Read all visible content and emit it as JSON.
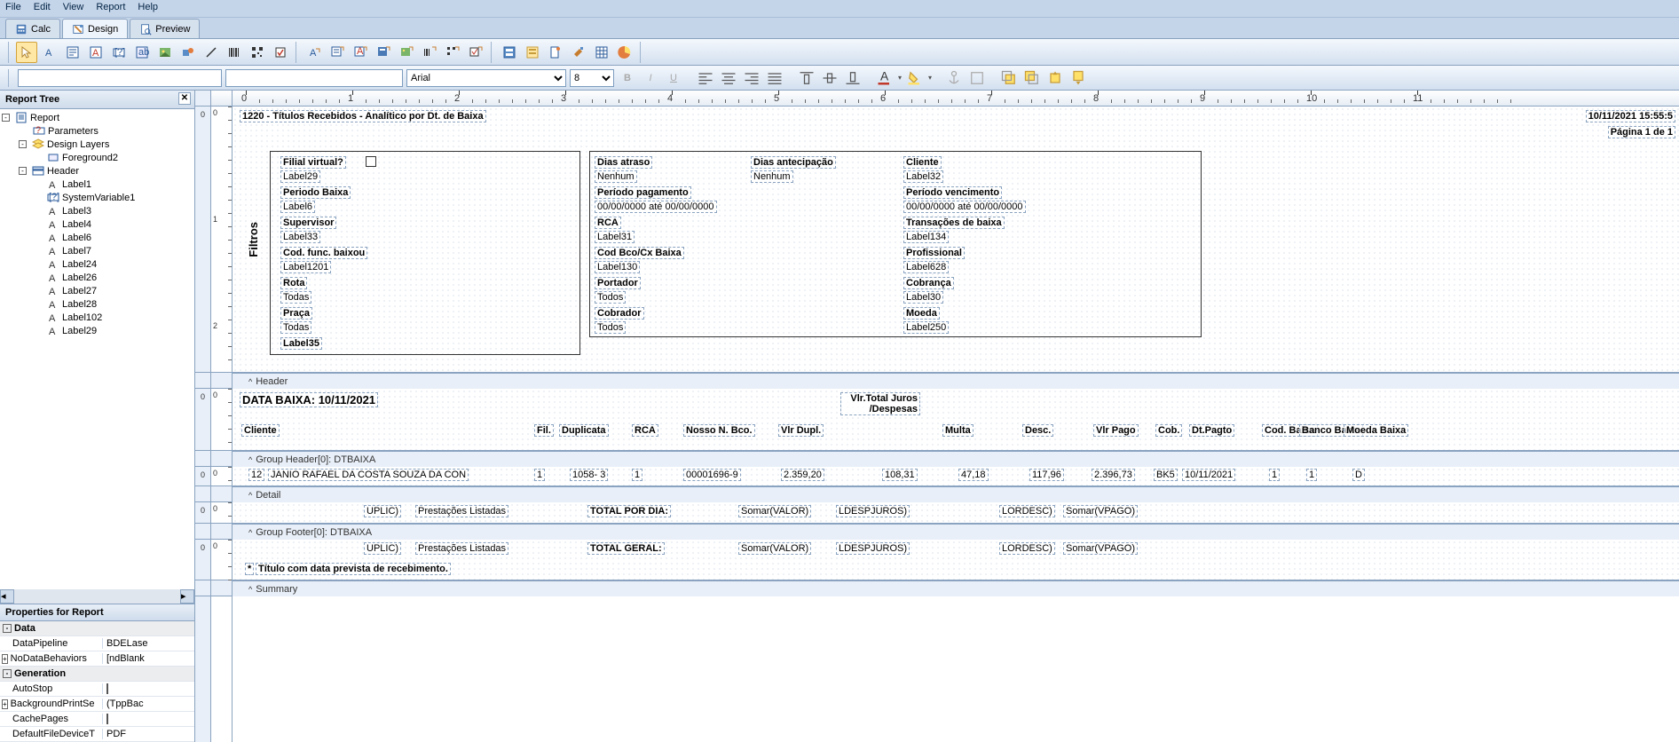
{
  "menu": {
    "file": "File",
    "edit": "Edit",
    "view": "View",
    "report": "Report",
    "help": "Help"
  },
  "tabs": {
    "calc": "Calc",
    "design": "Design",
    "preview": "Preview"
  },
  "fmt": {
    "font": "Arial",
    "size": "8"
  },
  "tree": {
    "title": "Report Tree",
    "root": "Report",
    "nodes": [
      {
        "indent": 1,
        "exp": "",
        "icon": "param",
        "label": "Parameters"
      },
      {
        "indent": 1,
        "exp": "-",
        "icon": "layers",
        "label": "Design Layers"
      },
      {
        "indent": 2,
        "exp": "",
        "icon": "layer",
        "label": "Foreground2"
      },
      {
        "indent": 1,
        "exp": "-",
        "icon": "band",
        "label": "Header"
      },
      {
        "indent": 2,
        "exp": "",
        "icon": "A",
        "label": "Label1"
      },
      {
        "indent": 2,
        "exp": "",
        "icon": "sys",
        "label": "SystemVariable1"
      },
      {
        "indent": 2,
        "exp": "",
        "icon": "A",
        "label": "Label3"
      },
      {
        "indent": 2,
        "exp": "",
        "icon": "A",
        "label": "Label4"
      },
      {
        "indent": 2,
        "exp": "",
        "icon": "A",
        "label": "Label6"
      },
      {
        "indent": 2,
        "exp": "",
        "icon": "A",
        "label": "Label7"
      },
      {
        "indent": 2,
        "exp": "",
        "icon": "A",
        "label": "Label24"
      },
      {
        "indent": 2,
        "exp": "",
        "icon": "A",
        "label": "Label26"
      },
      {
        "indent": 2,
        "exp": "",
        "icon": "A",
        "label": "Label27"
      },
      {
        "indent": 2,
        "exp": "",
        "icon": "A",
        "label": "Label28"
      },
      {
        "indent": 2,
        "exp": "",
        "icon": "A",
        "label": "Label102"
      },
      {
        "indent": 2,
        "exp": "",
        "icon": "A",
        "label": "Label29"
      }
    ]
  },
  "props": {
    "title": "Properties for Report",
    "groups": [
      {
        "name": "Data",
        "rows": [
          {
            "n": "DataPipeline",
            "v": "BDELase"
          },
          {
            "n": "NoDataBehaviors",
            "v": "[ndBlank",
            "exp": "+"
          }
        ]
      },
      {
        "name": "Generation",
        "rows": [
          {
            "n": "AutoStop",
            "v": "",
            "chk": true
          },
          {
            "n": "BackgroundPrintSe",
            "v": "(TppBac",
            "exp": "+"
          },
          {
            "n": "CachePages",
            "v": "",
            "chk": true
          },
          {
            "n": "DefaultFileDeviceT",
            "v": "PDF"
          }
        ]
      }
    ]
  },
  "canvas": {
    "title": "1220 - Títulos Recebidos - Analítico por Dt. de Baixa",
    "datetime": "10/11/2021 15:55:5",
    "page": "Página 1 de 1",
    "filtersLabel": "Filtros",
    "filterRows": [
      {
        "c1": {
          "l": "Filial virtual?",
          "v": "Label29"
        },
        "c2": {
          "l": "Dias atraso",
          "v": "Nenhum"
        },
        "c3": {
          "l": "Dias antecipação",
          "v": "Nenhum"
        },
        "c4": {
          "l": "Cliente",
          "v": "Label32"
        }
      },
      {
        "c1": {
          "l": "Periodo Baixa",
          "v": "Label6"
        },
        "c2": {
          "l": "Período pagamento",
          "v": "00/00/0000  até  00/00/0000"
        },
        "c3": null,
        "c4": {
          "l": "Período vencimento",
          "v": "00/00/0000  até  00/00/0000"
        }
      },
      {
        "c1": {
          "l": "Supervisor",
          "v": "Label33"
        },
        "c2": {
          "l": "RCA",
          "v": "Label31"
        },
        "c3": null,
        "c4": {
          "l": "Transações de baixa",
          "v": "Label134"
        }
      },
      {
        "c1": {
          "l": "Cod. func. baixou",
          "v": "Label1201"
        },
        "c2": {
          "l": "Cod Bco/Cx Baixa",
          "v": "Label130"
        },
        "c3": null,
        "c4": {
          "l": "Profissional",
          "v": "Label628"
        }
      },
      {
        "c1": {
          "l": "Rota",
          "v": "Todas"
        },
        "c2": {
          "l": "Portador",
          "v": "Todos"
        },
        "c3": null,
        "c4": {
          "l": "Cobrança",
          "v": "Label30"
        }
      },
      {
        "c1": {
          "l": "Praça",
          "v": "Todas"
        },
        "c2": {
          "l": "Cobrador",
          "v": "Todos"
        },
        "c3": null,
        "c4": {
          "l": "Moeda",
          "v": "Label250"
        }
      },
      {
        "c1": {
          "l": "Label35",
          "v": ""
        },
        "c2": null,
        "c3": null,
        "c4": null
      }
    ],
    "bands": {
      "header": "Header",
      "groupHeader": "Group Header[0]: DTBAIXA",
      "detail": "Detail",
      "groupFooter": "Group Footer[0]: DTBAIXA",
      "summary": "Summary"
    },
    "dataBaixa": "DATA BAIXA:  10/11/2021",
    "cols": {
      "cliente": "Cliente",
      "fil": "Fil.",
      "dupl": "Duplicata",
      "rca": "RCA",
      "nosso": "Nosso N. Bco.",
      "vlrdupl": "Vlr Dupl.",
      "juros": "Vlr.Total Juros /Despesas",
      "multa": "Multa",
      "desc": "Desc.",
      "vlrpago": "Vlr Pago",
      "cob": "Cob.",
      "dtpagto": "Dt.Pagto",
      "codbaixa": "Cod. Baixa",
      "bancobaixa": "Banco Baixa",
      "moedabaixa": "Moeda Baixa"
    },
    "detailRow": {
      "id": "12",
      "cliente": "JANIO RAFAEL DA COSTA SOUZA DA CON",
      "fil": "1",
      "dupl": "1058- 3",
      "rca": "1",
      "nosso": "00001696-9",
      "vlrdupl": "2.359,20",
      "juros": "108,31",
      "multa": "47,18",
      "desc": "117,96",
      "vlrpago": "2.396,73",
      "cob": "BK5",
      "dtpagto": "10/11/2021",
      "codbaixa": "1",
      "bancobaixa": "1",
      "moedabaixa": "D"
    },
    "footerRow": {
      "uplic": "UPLIC)",
      "prest": "Prestações Listadas",
      "totaldia": "TOTAL POR DIA:",
      "totalg": "TOTAL GERAL:",
      "somarvalor": "Somar(VALOR)",
      "despjuros": "LDESPJUROS)",
      "lordesc": "LORDESC)",
      "somarvpago": "Somar(VPAGO)"
    },
    "noteStar": "*",
    "note": "Título com data prevista  de recebimento."
  },
  "ruler": {
    "nums": [
      "0",
      "1",
      "2",
      "3",
      "4",
      "5",
      "6",
      "7",
      "8",
      "9",
      "10",
      "11"
    ]
  }
}
